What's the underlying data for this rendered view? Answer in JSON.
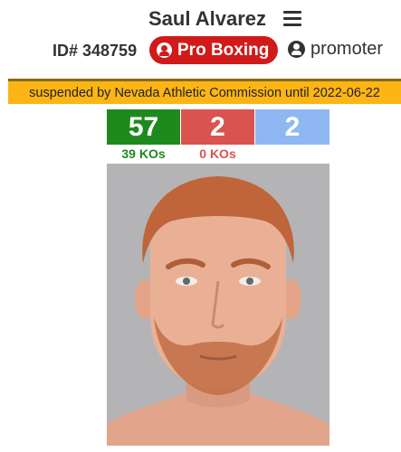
{
  "header": {
    "name": "Saul Alvarez",
    "menu_icon": "hamburger-menu-icon"
  },
  "info": {
    "id_text": "ID# 348759",
    "sport_label": "Pro Boxing",
    "sport_icon": "user-circle-icon",
    "role_label": "promoter",
    "role_icon": "user-circle-icon"
  },
  "suspension": {
    "text": "suspended by Nevada Athletic Commission until 2022-06-22"
  },
  "record": {
    "wins": "57",
    "losses": "2",
    "draws": "2",
    "win_kos": "39 KOs",
    "loss_kos": "0 KOs"
  },
  "colors": {
    "win": "#1e8a1e",
    "loss": "#d9534f",
    "draw": "#8fb8f2",
    "badge": "#d11a1a",
    "banner": "#fdb515"
  }
}
